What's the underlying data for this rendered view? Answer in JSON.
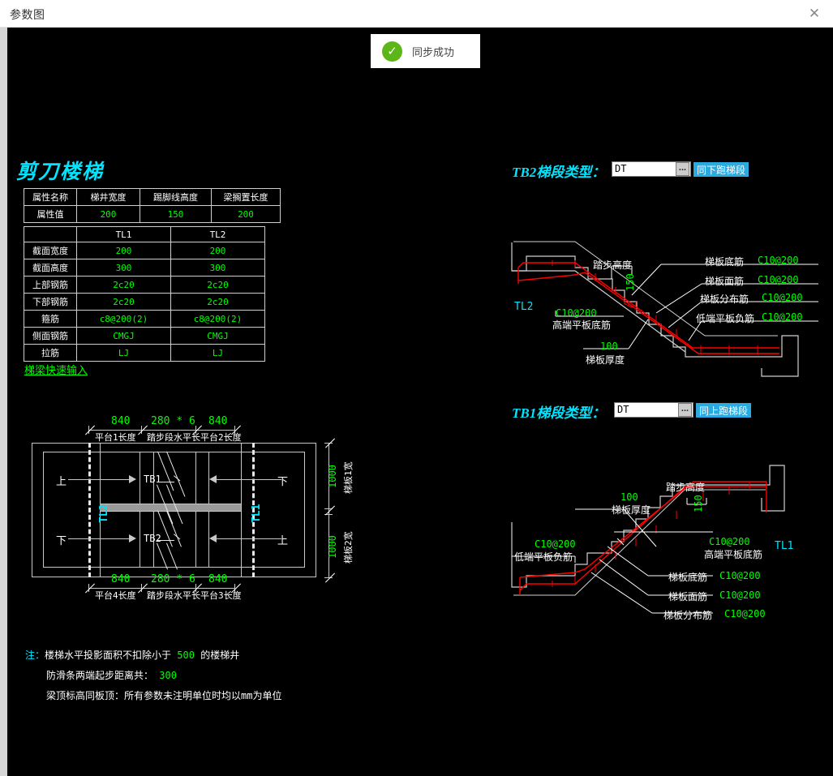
{
  "window": {
    "title": "参数图",
    "close_icon": "close-icon"
  },
  "toast": {
    "message": "同步成功",
    "icon": "check-circle-icon",
    "color": "#5cb617"
  },
  "heading": "剪刀楼梯",
  "attr_table": {
    "headers": [
      "属性名称",
      "梯井宽度",
      "踢脚线高度",
      "梁搁置长度"
    ],
    "value_label": "属性值",
    "values": [
      "200",
      "150",
      "200"
    ]
  },
  "beam_table": {
    "corner": "",
    "columns": [
      "TL1",
      "TL2"
    ],
    "rows": [
      {
        "label": "截面宽度",
        "tl1": "200",
        "tl2": "200"
      },
      {
        "label": "截面高度",
        "tl1": "300",
        "tl2": "300"
      },
      {
        "label": "上部钢筋",
        "tl1": "2c20",
        "tl2": "2c20"
      },
      {
        "label": "下部钢筋",
        "tl1": "2c20",
        "tl2": "2c20"
      },
      {
        "label": "箍筋",
        "tl1": "c8@200(2)",
        "tl2": "c8@200(2)"
      },
      {
        "label": "侧面钢筋",
        "tl1": "CMGJ",
        "tl2": "CMGJ"
      },
      {
        "label": "拉筋",
        "tl1": "LJ",
        "tl2": "LJ"
      }
    ]
  },
  "quick_link": "梯梁快速输入",
  "plan": {
    "top_dims": [
      {
        "value": "840",
        "label": "平台1长度"
      },
      {
        "value": "280 * 6",
        "label": "踏步段水平长"
      },
      {
        "value": "840",
        "label": "平台2长度"
      }
    ],
    "bottom_dims": [
      {
        "value": "840",
        "label": "平台4长度"
      },
      {
        "value": "280 * 6",
        "label": "踏步段水平长"
      },
      {
        "value": "840",
        "label": "平台3长度"
      }
    ],
    "right_dims": [
      {
        "value": "1000",
        "label": "梯板1宽"
      },
      {
        "value": "1000",
        "label": "梯板2宽"
      }
    ],
    "up_label": "上",
    "down_label": "下",
    "slab_top": "TB1",
    "slab_bottom": "TB2",
    "beam_left": "TL2",
    "beam_right": "TL1"
  },
  "section_tb2": {
    "title": "TB2梯段类型：",
    "input_value": "DT",
    "input_placeholder": "",
    "dots": "...",
    "badge": "同下跑梯段",
    "step_height_label": "踏步高度",
    "step_height_value": "150",
    "thickness_label": "梯板厚度",
    "thickness_value": "100",
    "beam_label": "TL2",
    "annotations": [
      {
        "label": "梯板底筋",
        "value": "C10@200"
      },
      {
        "label": "梯板面筋",
        "value": "C10@200"
      },
      {
        "label": "梯板分布筋",
        "value": "C10@200"
      },
      {
        "label": "低端平板负筋",
        "value": "C10@200"
      }
    ],
    "high_end": {
      "label": "高端平板底筋",
      "value": "C10@200"
    }
  },
  "section_tb1": {
    "title": "TB1梯段类型：",
    "input_value": "DT",
    "input_placeholder": "",
    "dots": "...",
    "badge": "同上跑梯段",
    "step_height_label": "踏步高度",
    "step_height_value": "150",
    "thickness_label": "梯板厚度",
    "thickness_value": "100",
    "beam_label": "TL1",
    "annotations": [
      {
        "label": "梯板底筋",
        "value": "C10@200"
      },
      {
        "label": "梯板面筋",
        "value": "C10@200"
      },
      {
        "label": "梯板分布筋",
        "value": "C10@200"
      }
    ],
    "low_end": {
      "label": "低端平板负筋",
      "value": "C10@200"
    },
    "high_end": {
      "label": "高端平板底筋",
      "value": "C10@200"
    }
  },
  "notes": {
    "prefix": "注：",
    "line1_a": "楼梯水平投影面积不扣除小于",
    "line1_v": "500",
    "line1_b": "的楼梯井",
    "line2_a": "防滑条两端起步距离共：",
    "line2_v": "300",
    "line3": "梁顶标高同板顶：所有参数未注明单位时均以mm为单位"
  },
  "colors": {
    "accent": "#00e5ff",
    "value": "#00ff00",
    "rebar": "#ff0000",
    "badge": "#29abe2"
  }
}
